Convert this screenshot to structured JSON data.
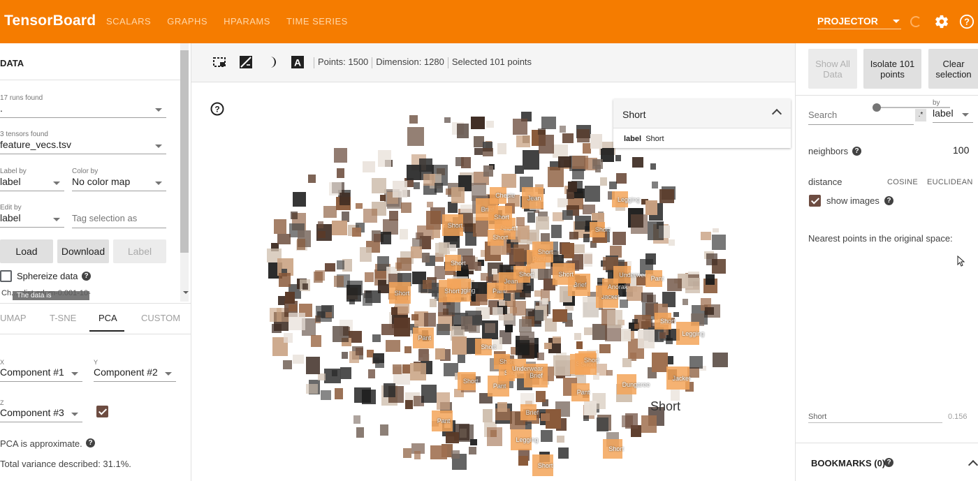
{
  "header": {
    "brand": "TensorBoard",
    "tabs": [
      "SCALARS",
      "GRAPHS",
      "HPARAMS",
      "TIME SERIES"
    ],
    "projector_select": "PROJECTOR",
    "accent_color": "#f57c00"
  },
  "left": {
    "title": "DATA",
    "runs_label": "17 runs found",
    "runs_value": ".",
    "tensors_label": "3 tensors found",
    "tensors_value": "feature_vecs.tsv",
    "label_by_label": "Label by",
    "label_by_value": "label",
    "color_by_label": "Color by",
    "color_by_value": "No color map",
    "edit_by_label": "Edit by",
    "edit_by_value": "label",
    "tag_placeholder": "Tag selection as",
    "load_btn": "Load",
    "download_btn": "Download",
    "label_btn": "Label",
    "sphereize_label": "Sphereize data",
    "checkpoint_text": "Ch... alist-adam-0.001-10-",
    "tooltip_text": "The data is",
    "proj_tabs": [
      "UMAP",
      "T-SNE",
      "PCA",
      "CUSTOM"
    ],
    "active_tab": "PCA",
    "x_label": "X",
    "x_value": "Component #1",
    "y_label": "Y",
    "y_value": "Component #2",
    "z_label": "Z",
    "z_value": "Component #3",
    "pca_approx": "PCA is approximate.",
    "variance": "Total variance described: 31.1%."
  },
  "center": {
    "points": "Points: 1500",
    "dimension": "Dimension: 1280",
    "selected": "Selected 101 points",
    "search_result_title": "Short",
    "search_row_key": "label",
    "search_row_val": "Short",
    "big_label": "Short",
    "point_labels": [
      "Short",
      "Underwear",
      "Short",
      "Short",
      "Short",
      "Short",
      "Legging",
      "Jean",
      "Short",
      "Short",
      "Brief",
      "Brief",
      "Brief",
      "Short",
      "Short",
      "Pant",
      "Legging",
      "Dungaree",
      "Jacket",
      "Short",
      "Pant",
      "Jacket",
      "Pant",
      "Short",
      "Short",
      "Short",
      "Short",
      "Brief",
      "Pant",
      "Short",
      "Pant",
      "Legging",
      "Short",
      "Short",
      "Underwear",
      "Short",
      "Chesie",
      "Short",
      "Jean",
      "Short",
      "Legging",
      "Short",
      "Anorak",
      "Pant",
      "Pant"
    ]
  },
  "right": {
    "btn_show_all": "Show All Data",
    "btn_isolate": "Isolate 101 points",
    "btn_clear": "Clear selection",
    "search_placeholder": "Search",
    "regex_symbol": ".*",
    "by_label": "by",
    "by_value": "label",
    "neighbors_label": "neighbors",
    "neighbors_value": "100",
    "distance_label": "distance",
    "cosine": "COSINE",
    "euclidean": "EUCLIDEAN",
    "show_images": "show images",
    "nearest_title": "Nearest points in the original space:",
    "nearest_item": "Short",
    "nearest_value": "0.156",
    "bookmarks": "BOOKMARKS (0)"
  }
}
